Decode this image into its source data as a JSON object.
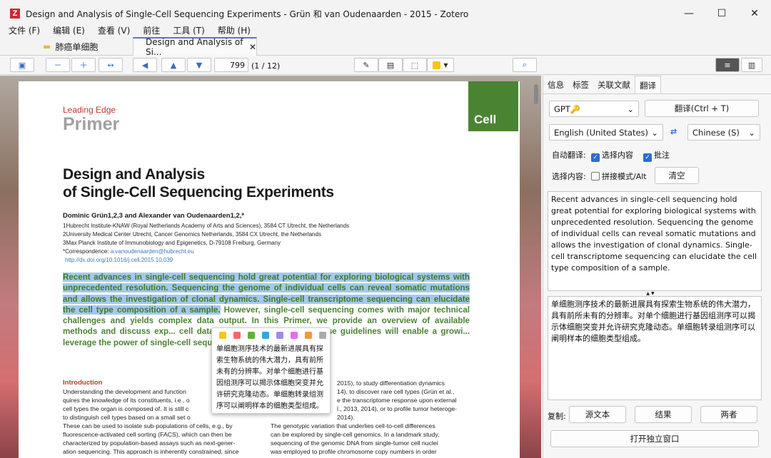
{
  "window": {
    "title": "Design and Analysis of Single-Cell Sequencing Experiments - Grün 和 van Oudenaarden - 2015 - Zotero",
    "logo": "Z"
  },
  "menu": [
    "文件 (F)",
    "编辑 (E)",
    "查看 (V)",
    "前往",
    "工具 (T)",
    "帮助 (H)"
  ],
  "tabs": [
    {
      "label": "肺癌单细胞"
    },
    {
      "label": "Design and Analysis of Si..."
    }
  ],
  "toolbar": {
    "page_value": "799",
    "page_info": "(1 / 12)",
    "highlight_color": "#f5c518"
  },
  "paper": {
    "header_lead": "Leading Edge",
    "header_primer": "Primer",
    "journal": "Cell",
    "title1": "Design and Analysis",
    "title2": "of Single-Cell Sequencing Experiments",
    "authors": "Dominic Grün1,2,3 and Alexander van Oudenaarden1,2,*",
    "aff1": "1Hubrecht Institute-KNAW (Royal Netherlands Academy of Arts and Sciences), 3584 CT Utrecht, the Netherlands",
    "aff2": "2University Medical Center Utrecht, Cancer Genomics Netherlands, 3584 CX Utrecht, the Netherlands",
    "aff3": "3Max Planck Institute of Immunobiology and Epigenetics, D-79108 Freiburg, Germany",
    "correspondence": "*Correspondence: ",
    "email": "a.vanoudenaarden@hubrecht.eu",
    "doi": "http://dx.doi.org/10.1016/j.cell.2015.10.039",
    "abstract_highlighted": "Recent advances in single-cell sequencing hold great potential for exploring biological systems with unprecedented resolution. Sequencing the genome of individual cells can reveal somatic mutations and allows the investigation of clonal dynamics. Single-cell transcriptome sequencing can elucidate the cell type composition of a sample.",
    "abstract_rest": " However, single-cell sequencing comes with major technical challenges and yields complex data output. In this Primer, we provide an overview of available methods and discuss exp... cell data analysis. We hope that these guidelines will enable a growi... leverage the power of single-cell sequencing.",
    "intro_heading": "Introduction",
    "left_col": [
      "Understanding the development and function",
      "quires the knowledge of its constituents, i.e., o",
      "cell types the organ is composed of. It is still c",
      "to distinguish cell types based on a small set o",
      "These can be used to isolate sub-populations of cells, e.g., by",
      "fluorescence-activated cell sorting (FACS), which can then be",
      "characterized by population-based assays such as next-gener-",
      "ation sequencing. This approach is inherently constrained, since"
    ],
    "right_col": [
      "2015), to study differentiation dynamics",
      "14), to discover rare cell types (Grün et al.,",
      "e the transcriptome response upon external",
      "l., 2013, 2014), or to profile tumor heteroge-",
      "2014).",
      "The genotypic variation that underlies cell-to-cell differences",
      "can be explored by single-cell genomics. In a landmark study,",
      "sequencing of the genomic DNA from single-tumor cell nuclei",
      "was employed to profile chromosome copy numbers in order"
    ]
  },
  "popup": {
    "colors": [
      "#f5c518",
      "#ff6666",
      "#5fb236",
      "#2ea8e5",
      "#a28ae5",
      "#e56eee",
      "#f19837",
      "#aaaaaa"
    ],
    "text": "单细胞测序技术的最新进展具有探索生物系统的伟大潜力，具有前所未有的分辨率。对单个细胞进行基因组测序可以揭示体细胞突变并允许研究克隆动态。单细胞转录组测序可以阐明样本的细胞类型组成。"
  },
  "panel": {
    "tabs": [
      "信息",
      "标签",
      "关联文献",
      "翻译"
    ],
    "engine": "GPT🔑",
    "translate_button": "翻译(Ctrl + T)",
    "source_lang": "English (United States)",
    "target_lang": "Chinese (S)",
    "auto_label": "自动翻译:",
    "auto_opt1": "选择内容",
    "auto_opt2": "批注",
    "select_label": "选择内容:",
    "concat_label": "拼接模式/Alt",
    "clear_button": "清空",
    "source_text": "Recent advances in single-cell sequencing hold great potential for exploring biological systems with unprecedented resolution. Sequencing the genome of individual cells can reveal somatic mutations and allows the investigation of clonal dynamics. Single-cell transcriptome sequencing can elucidate the cell type composition of a sample.",
    "result_text": "单细胞测序技术的最新进展具有探索生物系统的伟大潜力，具有前所未有的分辨率。对单个细胞进行基因组测序可以揭示体细胞突变并允许研究克隆动态。单细胞转录组测序可以阐明样本的细胞类型组成。",
    "copy_label": "复制:",
    "copy_source": "源文本",
    "copy_result": "结果",
    "copy_both": "两者",
    "standalone_button": "打开独立窗口"
  }
}
